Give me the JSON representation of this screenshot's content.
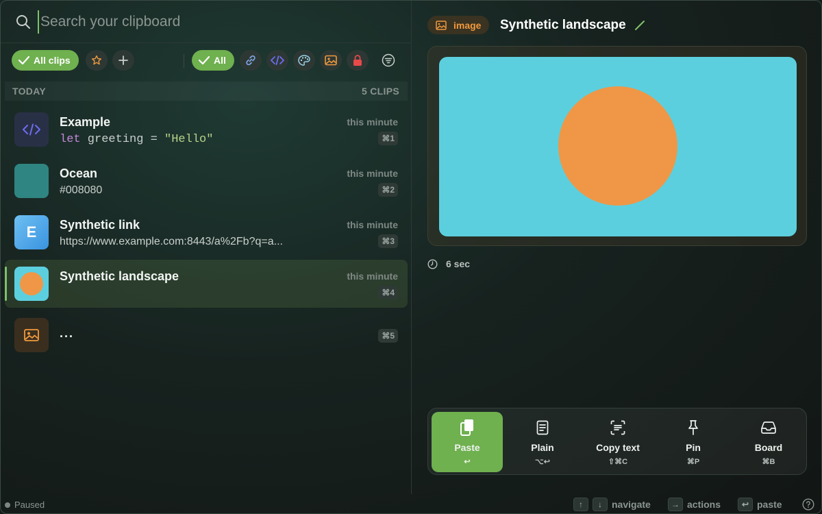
{
  "search": {
    "placeholder": "Search your clipboard"
  },
  "filters": {
    "all_clips_label": "All clips",
    "all_label": "All",
    "types": [
      {
        "icon": "star-icon",
        "color": "#f09a3e"
      },
      {
        "icon": "plus-icon",
        "color": "#c9d0cd"
      },
      {
        "icon": "link-icon",
        "color": "#7ea6e8"
      },
      {
        "icon": "code-icon",
        "color": "#6f6cf0"
      },
      {
        "icon": "palette-icon",
        "color": "#9ad2e8"
      },
      {
        "icon": "image-icon",
        "color": "#f09a3e"
      },
      {
        "icon": "lock-icon",
        "color": "#e84a4a"
      },
      {
        "icon": "filter-icon",
        "color": "#c9d0cd"
      }
    ]
  },
  "section": {
    "label": "TODAY",
    "count": "5 CLIPS"
  },
  "clips": [
    {
      "title": "Example",
      "code_keyword": "let",
      "code_mid": " greeting = ",
      "code_string": "\"Hello\"",
      "time": "this minute",
      "shortcut": "⌘1",
      "icon": "code-icon"
    },
    {
      "title": "Ocean",
      "subtitle": "#008080",
      "time": "this minute",
      "shortcut": "⌘2",
      "swatch": "#2f8582"
    },
    {
      "title": "Synthetic link",
      "subtitle": "https://www.example.com:8443/a%2Fb?q=a...",
      "time": "this minute",
      "shortcut": "⌘3",
      "letter": "E"
    },
    {
      "title": "Synthetic landscape",
      "time": "this minute",
      "shortcut": "⌘4",
      "icon": "image-thumbnail"
    },
    {
      "title": "...",
      "shortcut": "⌘5",
      "icon": "image-icon"
    }
  ],
  "preview": {
    "type_label": "image",
    "title": "Synthetic landscape",
    "age": "6 sec",
    "colors": {
      "sky": "#5ccfde",
      "sun": "#ef9746"
    }
  },
  "actions": [
    {
      "label": "Paste",
      "key": "↩",
      "icon": "paste-icon"
    },
    {
      "label": "Plain",
      "key": "⌥↩",
      "icon": "document-icon"
    },
    {
      "label": "Copy text",
      "key": "⇧⌘C",
      "icon": "text-scan-icon"
    },
    {
      "label": "Pin",
      "key": "⌘P",
      "icon": "pin-icon"
    },
    {
      "label": "Board",
      "key": "⌘B",
      "icon": "tray-icon"
    }
  ],
  "footer": {
    "status": "Paused",
    "navigate": "navigate",
    "actions": "actions",
    "paste": "paste"
  },
  "accent": "#6fb04f"
}
